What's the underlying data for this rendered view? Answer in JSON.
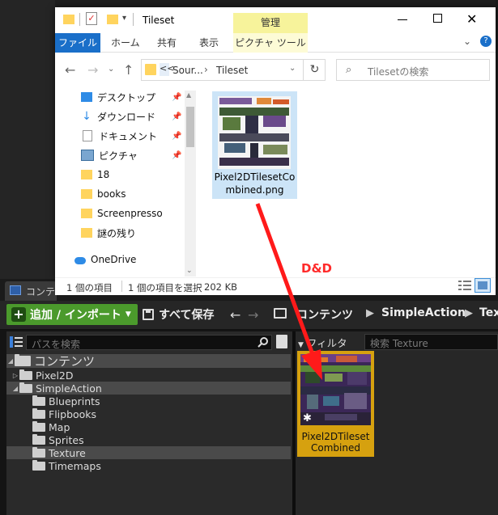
{
  "explorer": {
    "title": "Tileset",
    "manage_tab": "管理",
    "ribbon_tabs": [
      "ファイル",
      "ホーム",
      "共有",
      "表示",
      "ピクチャ ツール"
    ],
    "address": [
      "Sour...",
      "Tileset"
    ],
    "address_expand": "<<",
    "search_placeholder": "Tilesetの検索",
    "nav_items": [
      "デスクトップ",
      "ダウンロード",
      "ドキュメント",
      "ピクチャ",
      "18",
      "books",
      "Screenpresso",
      "謎の残り",
      "OneDrive"
    ],
    "file_name_line1": "Pixel2DTilesetCo",
    "file_name_line2": "mbined.png",
    "status": {
      "count": "1 個の項目",
      "selected": "1 個の項目を選択",
      "size": "202 KB"
    }
  },
  "annotation": {
    "label": "D&D",
    "color": "#ff2a2a"
  },
  "unreal": {
    "tab_label": "コンテ",
    "toolbar": {
      "add_import": "追加 / インポート",
      "save_all": "すべて保存",
      "breadcrumbs": [
        "コンテンツ",
        "SimpleAction",
        "Tex"
      ]
    },
    "path_search_placeholder": "パスを検索",
    "filter_label": "フィルタ",
    "asset_search_placeholder": "検索 Texture",
    "tree": {
      "root": "コンテンツ",
      "items": [
        "Pixel2D",
        "SimpleAction",
        "Blueprints",
        "Flipbooks",
        "Map",
        "Sprites",
        "Texture",
        "Timemaps"
      ]
    },
    "asset": {
      "name_line1": "Pixel2DTileset",
      "name_line2": "Combined"
    },
    "colors": {
      "accent_green": "#4b9a2c",
      "selection_gold": "#d6a10f",
      "explorer_blue": "#1a6fc9"
    }
  }
}
